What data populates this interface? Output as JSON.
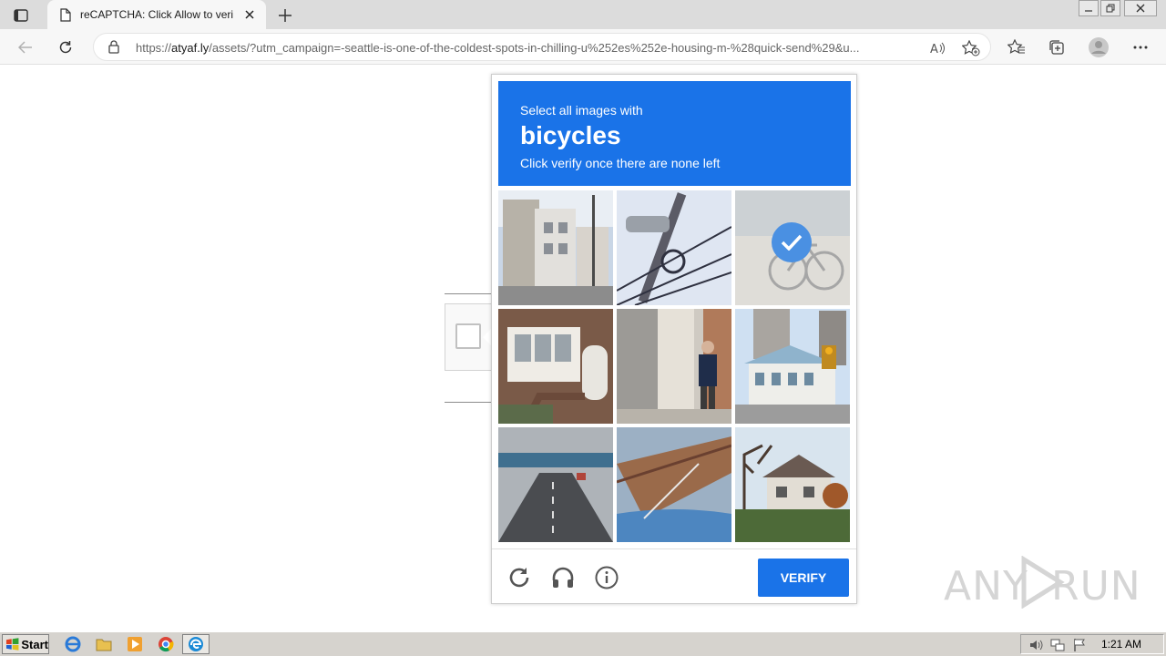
{
  "browser": {
    "tab_title": "reCAPTCHA: Click Allow to veri",
    "url_prefix": "https://",
    "url_host": "atyaf.ly",
    "url_rest": "/assets/?utm_campaign=-seattle-is-one-of-the-coldest-spots-in-chilling-u%252es%252e-housing-m-%28quick-send%29&u..."
  },
  "captcha": {
    "instruction_line1": "Select all images with",
    "target_word": "bicycles",
    "instruction_line3": "Click verify once there are none left",
    "tiles": [
      {
        "scene": "narrow street with buildings and utility pole",
        "selected": false
      },
      {
        "scene": "street lamp and wires against sky",
        "selected": false
      },
      {
        "scene": "parked bicycles",
        "selected": true
      },
      {
        "scene": "brick house with bay windows",
        "selected": false
      },
      {
        "scene": "person walking on sidewalk",
        "selected": false
      },
      {
        "scene": "towers and building with traffic light",
        "selected": false
      },
      {
        "scene": "highway with overpass",
        "selected": false
      },
      {
        "scene": "bridge railing and car hood",
        "selected": false
      },
      {
        "scene": "house behind trees",
        "selected": false
      }
    ],
    "verify_label": "VERIFY",
    "brand_color": "#1a73e8"
  },
  "watermark": {
    "left": "ANY",
    "right": "RUN"
  },
  "taskbar": {
    "start_label": "Start",
    "clock": "1:21 AM"
  }
}
